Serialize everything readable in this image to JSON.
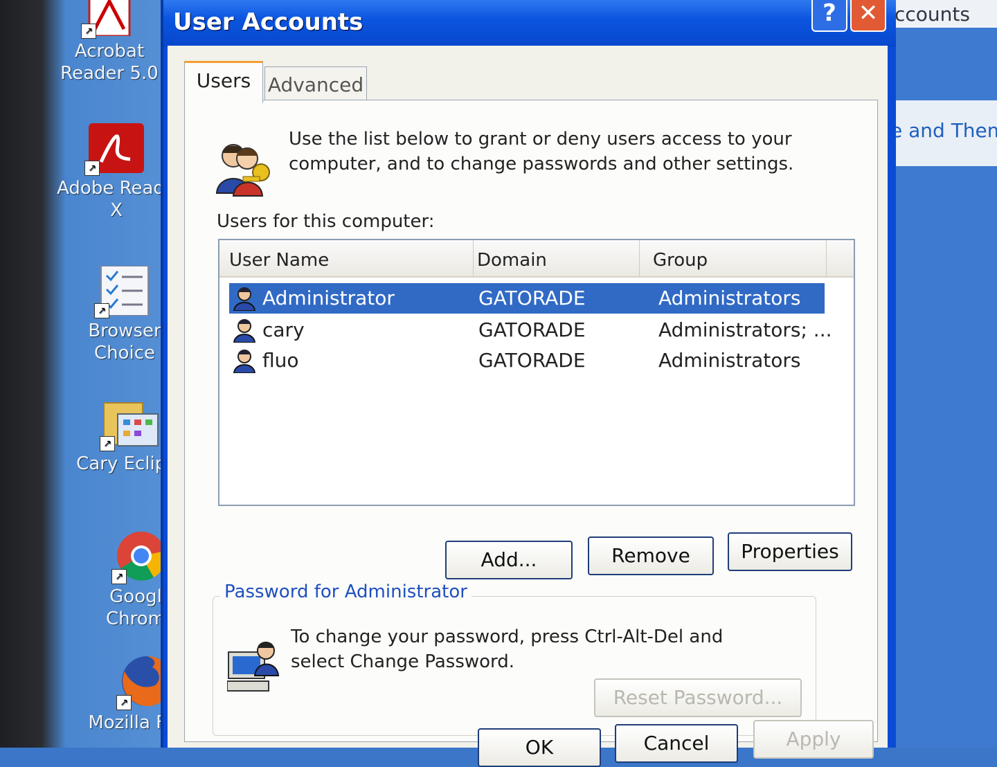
{
  "desktop": {
    "icons": [
      {
        "label": "Acrobat Reader 5.0"
      },
      {
        "label": "Adobe Reade X"
      },
      {
        "label": "Browser Choice"
      },
      {
        "label": "Cary Eclipse"
      },
      {
        "label": "Google Chrome"
      },
      {
        "label": "Mozilla Firefo"
      }
    ]
  },
  "background_window": {
    "title_fragment": "ccounts",
    "link_fragment": "e and Theme"
  },
  "dialog": {
    "title": "User Accounts",
    "help_glyph": "?",
    "close_glyph": "✕",
    "tabs": [
      {
        "label": "Users",
        "active": true
      },
      {
        "label": "Advanced",
        "active": false
      }
    ],
    "intro_text": "Use the list below to grant or deny users access to your computer, and to change passwords and other settings.",
    "users_label": "Users for this computer:",
    "list": {
      "columns": [
        "User Name",
        "Domain",
        "Group"
      ],
      "rows": [
        {
          "name": "Administrator",
          "domain": "GATORADE",
          "group": "Administrators",
          "selected": true
        },
        {
          "name": "cary",
          "domain": "GATORADE",
          "group": "Administrators; ...",
          "selected": false
        },
        {
          "name": "fluo",
          "domain": "GATORADE",
          "group": "Administrators",
          "selected": false
        }
      ]
    },
    "buttons": {
      "add": "Add...",
      "remove": "Remove",
      "properties": "Properties",
      "reset_password": "Reset Password...",
      "ok": "OK",
      "cancel": "Cancel",
      "apply": "Apply"
    },
    "password_group": {
      "legend": "Password for Administrator",
      "text": "To change your password, press Ctrl-Alt-Del and select Change Password."
    },
    "colors": {
      "title_bar": "#0b55e0",
      "selection": "#316ac5",
      "close_button": "#e25a33",
      "group_legend": "#1f4fc0"
    }
  }
}
